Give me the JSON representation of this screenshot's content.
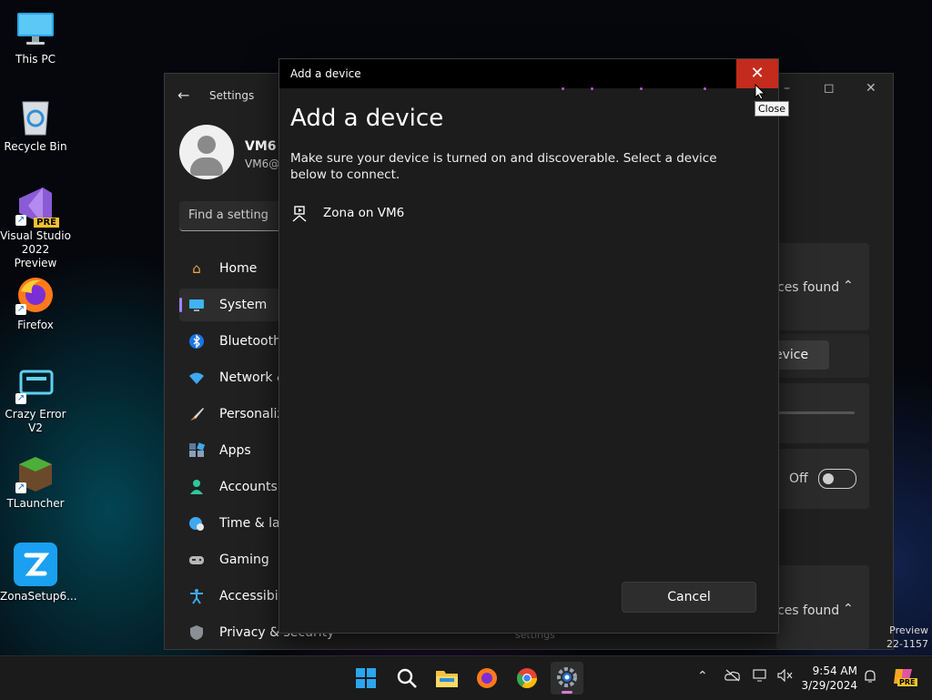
{
  "desktop": {
    "icons": [
      {
        "label": "This PC"
      },
      {
        "label": "Recycle Bin"
      },
      {
        "label": "Visual Studio 2022 Preview"
      },
      {
        "label": "Firefox"
      },
      {
        "label": "Crazy Error V2"
      },
      {
        "label": "TLauncher"
      },
      {
        "label": "ZonaSetup6..."
      }
    ],
    "vs_badge": "PRE"
  },
  "settings": {
    "title": "Settings",
    "user_name": "VM6",
    "user_email": "VM6@",
    "search_placeholder": "Find a setting",
    "nav": [
      {
        "label": "Home"
      },
      {
        "label": "System"
      },
      {
        "label": "Bluetooth"
      },
      {
        "label": "Network &"
      },
      {
        "label": "Personaliza"
      },
      {
        "label": "Apps"
      },
      {
        "label": "Accounts"
      },
      {
        "label": "Time & lan"
      },
      {
        "label": "Gaming"
      },
      {
        "label": "Accessibilit"
      },
      {
        "label": "Privacy & security"
      }
    ],
    "content": {
      "devices_found_1": "ces found",
      "add_device_btn": "evice",
      "toggle_label": "Off",
      "devices_found_2": "ces found",
      "bottom_text": "settings"
    }
  },
  "dialog": {
    "window_title": "Add a device",
    "heading": "Add a device",
    "description": "Make sure your device is turned on and discoverable. Select a device below to connect.",
    "devices": [
      {
        "name": "Zona on VM6"
      }
    ],
    "cancel_label": "Cancel",
    "close_tooltip": "Close"
  },
  "watermark": {
    "line1": "Preview",
    "line2": "22-1157"
  },
  "taskbar": {
    "time": "9:54 AM",
    "date": "3/29/2024",
    "copilot_badge": "PRE"
  },
  "colors": {
    "close_red": "#c42b1c",
    "accent": "#9c86ff"
  }
}
